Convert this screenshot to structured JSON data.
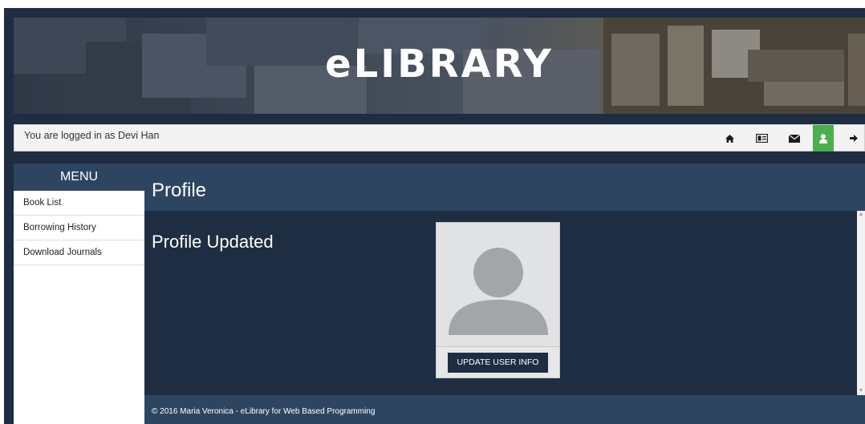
{
  "banner": {
    "title": "eLIBRARY"
  },
  "userbar": {
    "status_text": "You are logged in as Devi Han",
    "icons": [
      "home-icon",
      "id-card-icon",
      "envelope-icon",
      "user-icon",
      "sign-out-icon"
    ],
    "active_icon": "user-icon",
    "active_color": "#4cae4c"
  },
  "sidebar": {
    "header": "MENU",
    "items": [
      {
        "label": "Book List"
      },
      {
        "label": "Borrowing History"
      },
      {
        "label": "Download Journals"
      }
    ]
  },
  "main": {
    "title": "Profile",
    "status_message": "Profile Updated",
    "update_button_label": "UPDATE USER INFO"
  },
  "footer": {
    "text": "© 2016 Maria Veronica - eLibrary for Web Based Programming"
  },
  "colors": {
    "navy": "#1e2d42",
    "header_blue": "#2e4562",
    "active_green": "#4cae4c"
  }
}
